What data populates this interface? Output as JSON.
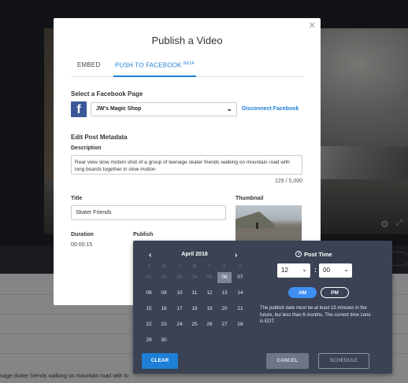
{
  "modal": {
    "title": "Publish a Video",
    "close_icon": "close-icon",
    "tabs": [
      {
        "label": "EMBED",
        "active": false
      },
      {
        "label": "PUSH TO FACEBOOK",
        "badge": "BETA",
        "active": true
      }
    ],
    "facebook": {
      "heading": "Select a Facebook Page",
      "logo_letter": "f",
      "page_selected": "JW's Magic Shop",
      "disconnect_label": "Disconnect Facebook"
    },
    "metadata": {
      "heading": "Edit Post Metadata",
      "description_label": "Description",
      "description_value": "Rear view slow motion shot of a group of teenage skater friends walking on mountain road with long boards together in slow motion",
      "char_count": "129 / 5,000",
      "title_label": "Title",
      "title_value": "Skater Friends",
      "thumbnail_label": "Thumbnail",
      "duration_label": "Duration",
      "duration_value": "00:00:15",
      "publish_label": "Publish"
    }
  },
  "picker": {
    "month_label": "April 2018",
    "prev_icon": "chevron-left-icon",
    "next_icon": "chevron-right-icon",
    "weekdays": [
      "S",
      "M",
      "T",
      "W",
      "T",
      "F",
      "S"
    ],
    "weeks": [
      [
        "01",
        "02",
        "03",
        "04",
        "05",
        "06",
        "07"
      ],
      [
        "08",
        "09",
        "10",
        "11",
        "12",
        "13",
        "14"
      ],
      [
        "15",
        "16",
        "17",
        "18",
        "19",
        "20",
        "21"
      ],
      [
        "22",
        "23",
        "24",
        "25",
        "26",
        "27",
        "28"
      ],
      [
        "29",
        "30",
        "",
        "",
        "",
        "",
        ""
      ]
    ],
    "selected_day": "06",
    "post_time_label": "Post Time",
    "hour": "12",
    "minute": "00",
    "am_label": "AM",
    "pm_label": "PM",
    "am_selected": true,
    "note": "The publish date must be at least 15 minutes in the future, but less than 6 months. The current time zone is EDT.",
    "clear_label": "CLEAR",
    "cancel_label": "CANCEL",
    "schedule_label": "SCHEDULE"
  },
  "background": {
    "description_snippet": "nage skater friends walking on mountain road with lo"
  },
  "colors": {
    "accent": "#1e7fd6",
    "facebook": "#3b5998",
    "picker_bg": "#3a4253"
  }
}
